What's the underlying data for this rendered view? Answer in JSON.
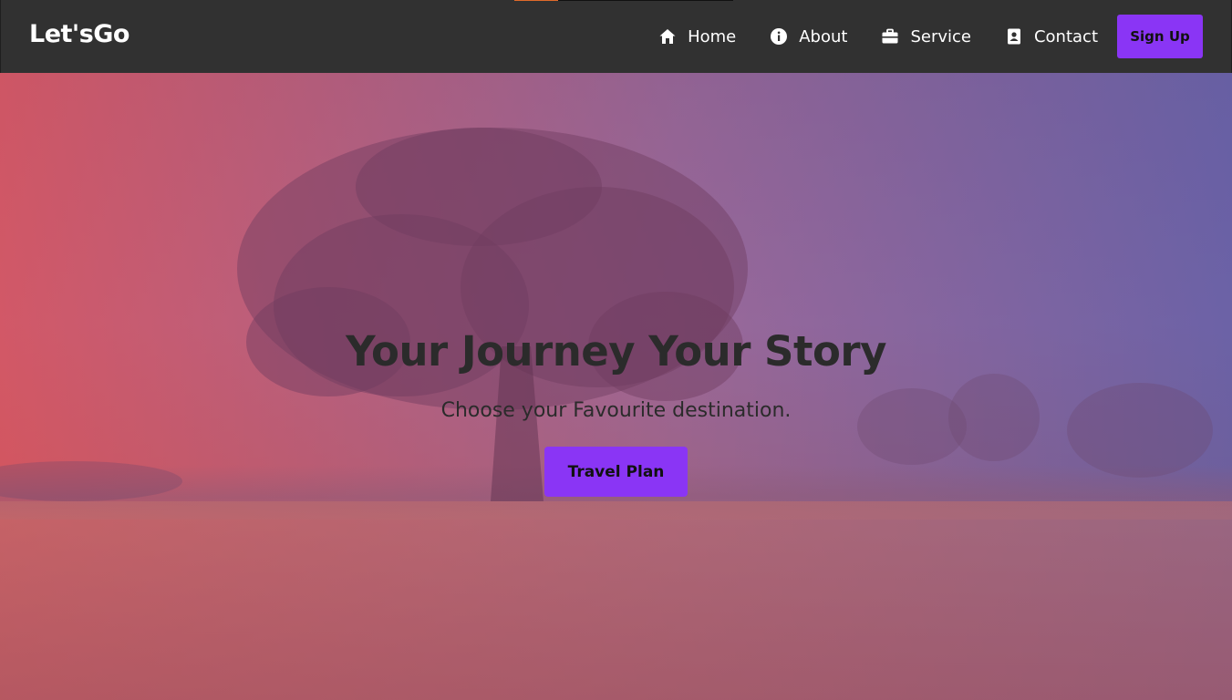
{
  "brand": {
    "name": "Let'sGo"
  },
  "nav": {
    "items": [
      {
        "label": "Home",
        "icon": "home-icon"
      },
      {
        "label": "About",
        "icon": "info-icon"
      },
      {
        "label": "Service",
        "icon": "briefcase-icon"
      },
      {
        "label": "Contact",
        "icon": "contact-card-icon"
      }
    ],
    "signup_label": "Sign Up"
  },
  "hero": {
    "title": "Your Journey Your Story",
    "subtitle": "Choose your Favourite destination.",
    "cta_label": "Travel Plan"
  },
  "colors": {
    "navbar": "#313131",
    "accent": "#8a35f5",
    "text_light": "#ffffff",
    "text_dark": "#2b2b2b",
    "strip_accent": "#e06a2a"
  }
}
